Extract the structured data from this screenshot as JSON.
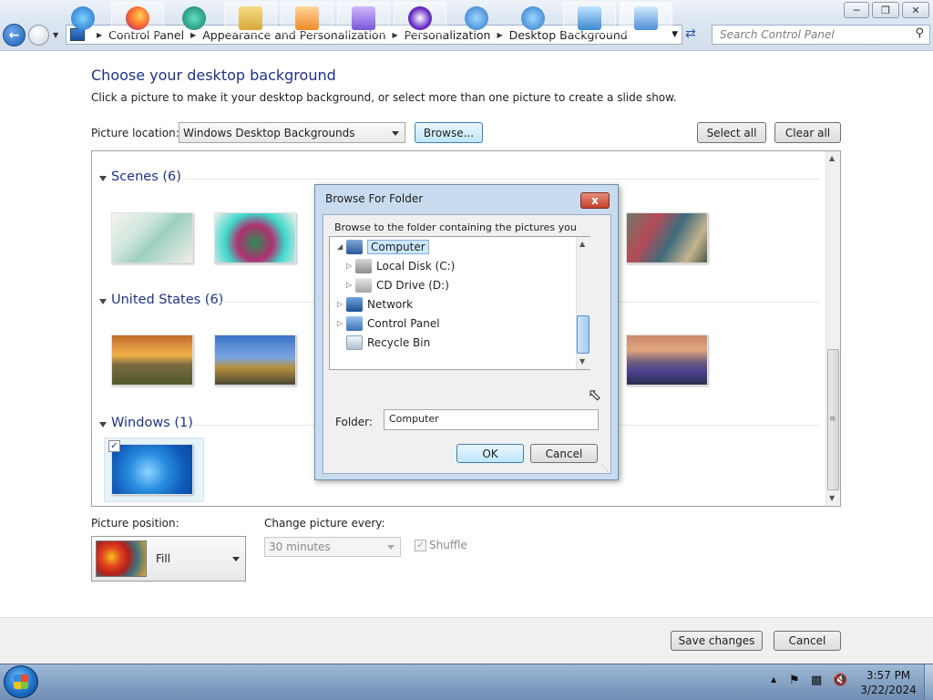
{
  "window": {
    "controls": [
      "minimize",
      "maximize",
      "close"
    ]
  },
  "nav": {
    "breadcrumbs": [
      "Control Panel",
      "Appearance and Personalization",
      "Personalization",
      "Desktop Background"
    ],
    "search_placeholder": "Search Control Panel"
  },
  "page": {
    "title": "Choose your desktop background",
    "subtitle": "Click a picture to make it your desktop background, or select more than one picture to create a slide show.",
    "picture_location_label": "Picture location:",
    "picture_location_value": "Windows Desktop Backgrounds",
    "browse_label": "Browse...",
    "select_all_label": "Select all",
    "clear_all_label": "Clear all"
  },
  "gallery": {
    "groups": [
      {
        "label": "Scenes (6)"
      },
      {
        "label": "United States (6)"
      },
      {
        "label": "Windows (1)"
      }
    ]
  },
  "dialog": {
    "title": "Browse For Folder",
    "close_label": "x",
    "instructions": "Browse to the folder containing the pictures you want to use for your desktop background.",
    "tree": [
      {
        "label": "Computer",
        "selected": true
      },
      {
        "label": "Local Disk (C:)"
      },
      {
        "label": "CD Drive (D:)"
      },
      {
        "label": "Network"
      },
      {
        "label": "Control Panel"
      },
      {
        "label": "Recycle Bin"
      }
    ],
    "folder_label": "Folder:",
    "folder_value": "Computer",
    "ok_label": "OK",
    "cancel_label": "Cancel"
  },
  "options": {
    "position_label": "Picture position:",
    "position_value": "Fill",
    "interval_label": "Change picture every:",
    "interval_value": "30 minutes",
    "shuffle_label": "Shuffle"
  },
  "footer": {
    "save_label": "Save changes",
    "cancel_label": "Cancel"
  },
  "taskbar": {
    "time": "3:57 PM",
    "date": "3/22/2024"
  },
  "colors": {
    "heading": "#1e3287",
    "selection": "#cce8ff",
    "taskbar": "#6e8db3"
  }
}
